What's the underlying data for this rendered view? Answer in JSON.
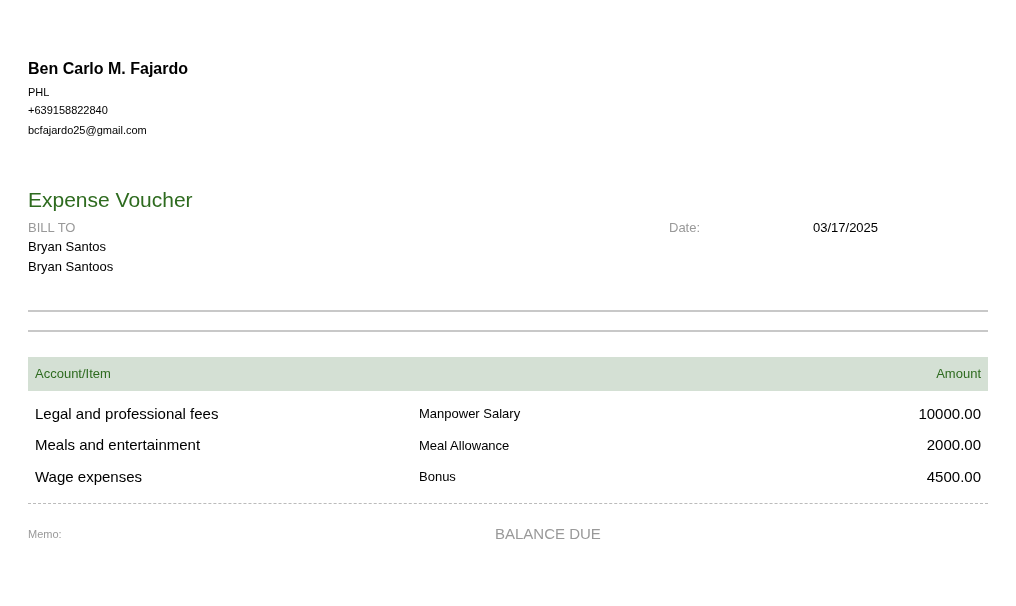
{
  "sender": {
    "name": "Ben Carlo M. Fajardo",
    "country": "PHL",
    "phone": "+639158822840",
    "email": "bcfajardo25@gmail.com"
  },
  "title": "Expense Voucher",
  "bill_to": {
    "label": "BILL TO",
    "lines": [
      "Bryan Santos",
      "Bryan Santoos"
    ]
  },
  "date": {
    "label": "Date:",
    "value": "03/17/2025"
  },
  "table": {
    "columns": [
      "Account/Item",
      "Amount"
    ],
    "rows": [
      {
        "account": "Legal and professional fees",
        "description": "Manpower Salary",
        "amount": "10000.00"
      },
      {
        "account": "Meals and entertainment",
        "description": "Meal Allowance",
        "amount": "2000.00"
      },
      {
        "account": "Wage expenses",
        "description": "Bonus",
        "amount": "4500.00"
      }
    ]
  },
  "memo_label": "Memo:",
  "balance_due_label": "BALANCE DUE"
}
